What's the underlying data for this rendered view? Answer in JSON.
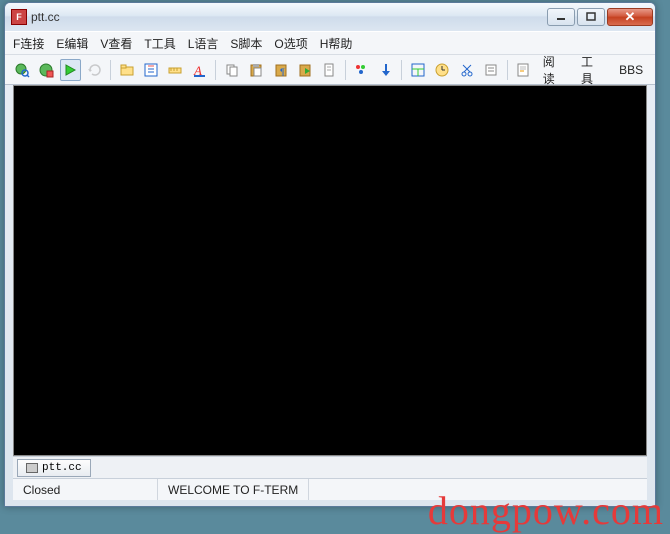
{
  "title": "ptt.cc",
  "menu": {
    "connect": "F连接",
    "edit": "E编辑",
    "view": "V查看",
    "tools": "T工具",
    "language": "L语言",
    "script": "S脚本",
    "options": "O选项",
    "help": "H帮助"
  },
  "toolbar_text": {
    "read": "阅读",
    "tools": "工具",
    "bbs": "BBS"
  },
  "tab": {
    "label": "ptt.cc"
  },
  "status": {
    "connection": "Closed",
    "welcome": "WELCOME TO F-TERM"
  },
  "watermark": "dongpow.com"
}
